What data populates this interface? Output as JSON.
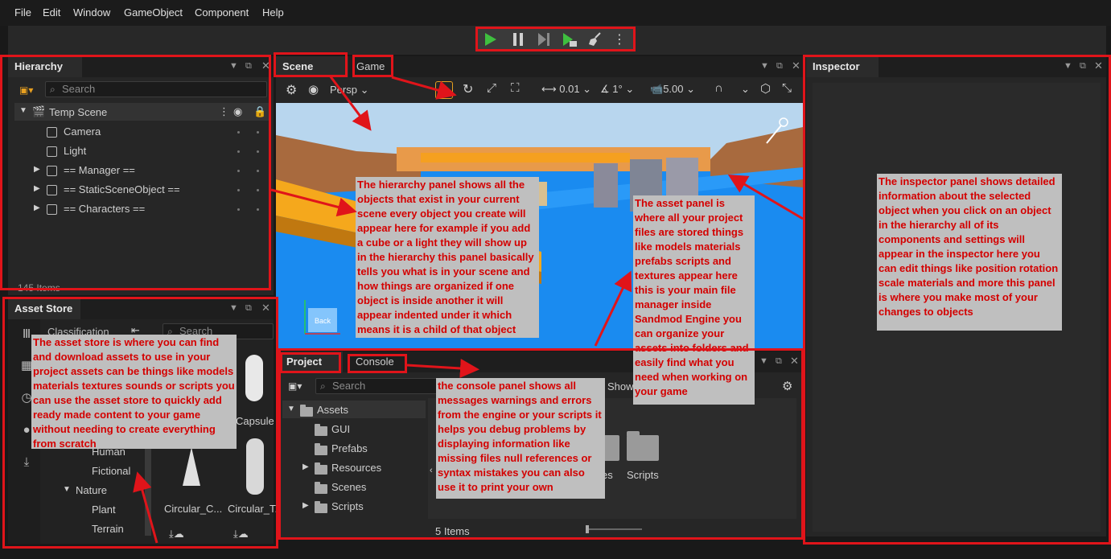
{
  "menu": [
    "File",
    "Edit",
    "Window",
    "GameObject",
    "Component",
    "Help"
  ],
  "play_controls": {
    "play": "play-icon",
    "pause": "pause-icon",
    "step": "step-icon",
    "run_scene": "run-scene-icon",
    "clean": "broom-icon",
    "more": "more-icon",
    "accent": "#3fbf3f"
  },
  "hierarchy": {
    "tab": "Hierarchy",
    "search_placeholder": "Search",
    "root": "Temp Scene",
    "items": [
      "Camera",
      "Light",
      "== Manager ==",
      "== StaticSceneObject ==",
      "== Characters =="
    ],
    "footer": "145 Items"
  },
  "scene": {
    "tabs": [
      "Scene",
      "Game"
    ],
    "projection": "Persp",
    "snap_move": "0.01",
    "snap_rotate": "1°",
    "camera_speed": "5.00",
    "gizmo_label": "Back"
  },
  "inspector": {
    "tab": "Inspector"
  },
  "asset_store": {
    "tab": "Asset Store",
    "classification": "Classification",
    "search_placeholder": "Search",
    "categories": [
      "Human",
      "Fictional",
      "Nature",
      "Plant",
      "Terrain"
    ],
    "items": [
      "Capsule",
      "Circular_C...",
      "Circular_T..."
    ]
  },
  "project": {
    "tabs": [
      "Project",
      "Console"
    ],
    "search_placeholder": "Search",
    "show_label": "Show",
    "tree": [
      "Assets",
      "GUI",
      "Prefabs",
      "Resources",
      "Scenes",
      "Scripts"
    ],
    "grid": [
      "es",
      "Scripts"
    ],
    "footer": "5 Items"
  },
  "notes": {
    "hierarchy": "The hierarchy panel shows all the objects that exist in your current scene every object you create will appear here for example if you add a cube or a light they will show up in the hierarchy this panel basically tells you what is in your scene and how things are organized if one object is inside another it will appear indented under it which means it is a child of that object",
    "asset": "The asset panel is where all your project files are stored things like models materials prefabs scripts and textures appear here this is your main file manager inside Sandmod Engine you can organize your assets into folders and easily find what you need when working on your game",
    "inspector": "The inspector panel shows detailed information about the selected object when you click on an object in the hierarchy all of its components and settings will appear in the inspector here you can edit things like position rotation scale materials and more this panel is where you make most of your changes to objects",
    "store": "The asset store is where you can find and download assets to use in your project assets can be things like models materials textures sounds or scripts you can use the asset store to quickly add ready made content to your game without needing to create everything from scratch",
    "console": "the console panel shows all messages warnings and errors from the engine or your scripts it helps you debug problems by displaying information like missing files null references or syntax mistakes you can also use it to print your own messages"
  },
  "colors": {
    "annotation_red": "#e0141a",
    "note_bg": "#bfbfbf",
    "note_text": "#d40000",
    "sky": "#b8d6ee",
    "water": "#1a8bf0",
    "ground": "#a86a3e"
  }
}
